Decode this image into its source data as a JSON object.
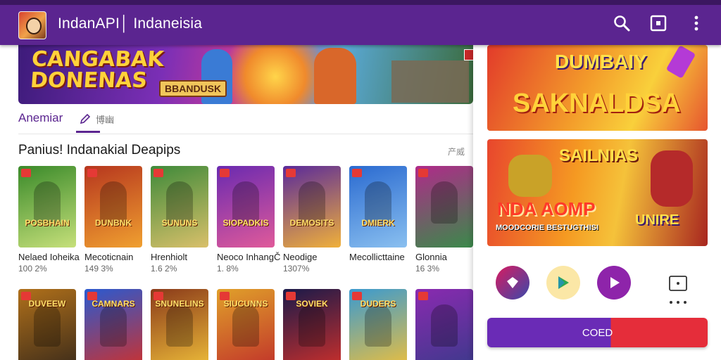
{
  "appbar": {
    "title": "IndanAPI│ Indaneisia",
    "icons": [
      "app-logo",
      "search-icon",
      "cast-icon",
      "more-vert-icon"
    ]
  },
  "banner": {
    "title_line1": "CANGABAK",
    "title_line2": "DONENAS",
    "tag": "BBANDUSK"
  },
  "tabs": {
    "active_label": "Anemiar",
    "second_label": "博幽"
  },
  "section": {
    "title": "Panius! Indanakial Deapips",
    "more": "产威"
  },
  "games_row1": [
    {
      "thumb_text": "POSBHAIN",
      "name": "Nelaed Ioheika",
      "meta": "100 2%",
      "colors": [
        "#3a8a2a",
        "#c6e07a"
      ]
    },
    {
      "thumb_text": "DUNBNK",
      "name": "Mecoticnain",
      "meta": "149 3%",
      "colors": [
        "#b6361e",
        "#f0a030"
      ]
    },
    {
      "thumb_text": "SUNUNS",
      "name": "Hrenhiolt",
      "meta": "1.6 2%",
      "colors": [
        "#3f8a3a",
        "#d9c06a"
      ]
    },
    {
      "thumb_text": "SIOPADKIS",
      "name": "Neoco InhangČ",
      "meta": "1. 8%",
      "colors": [
        "#6a2ab0",
        "#e05a9a"
      ]
    },
    {
      "thumb_text": "DEMOSITS",
      "name": "Neodige",
      "meta": "1307%",
      "colors": [
        "#5a2a9a",
        "#f0b03a"
      ]
    },
    {
      "thumb_text": "DMIERK",
      "name": "Mecollicttaine",
      "meta": "",
      "colors": [
        "#2a6ad0",
        "#8ac0f0"
      ]
    },
    {
      "thumb_text": "",
      "name": "Glonnia",
      "meta": "16 3%",
      "colors": [
        "#b02a8a",
        "#3a8a4a"
      ]
    }
  ],
  "games_row2": [
    {
      "thumb_text": "DUVEEW",
      "colors": [
        "#b0701a",
        "#3a2a1a"
      ]
    },
    {
      "thumb_text": "CAMNARS",
      "colors": [
        "#2a5ad0",
        "#d0302a"
      ]
    },
    {
      "thumb_text": "SNUNELINS",
      "colors": [
        "#8a3a1a",
        "#f0c03a"
      ]
    },
    {
      "thumb_text": "SIUCUNNS",
      "colors": [
        "#e0a02a",
        "#c0302a"
      ]
    },
    {
      "thumb_text": "SOVIEK",
      "colors": [
        "#1a1a4a",
        "#d0302a"
      ]
    },
    {
      "thumb_text": "DUDERS",
      "colors": [
        "#3a9ad0",
        "#f0c03a"
      ]
    },
    {
      "thumb_text": "",
      "colors": [
        "#8a2ab0",
        "#3a3a8a"
      ]
    }
  ],
  "side": {
    "promo1_line1": "DUMBAIY",
    "promo1_line2": "SAKNALDSA",
    "promo2_line1": "SAILNIAS",
    "promo2_line2": "NDA AOMP",
    "promo2_line3": "MOODCORIE BESTUGTHISI",
    "promo2_line4": "UNIRE",
    "store_icons": [
      "diamond-store-icon",
      "play-store-icon",
      "play-button-icon",
      "dice-icon"
    ],
    "cta_label": "COED"
  }
}
